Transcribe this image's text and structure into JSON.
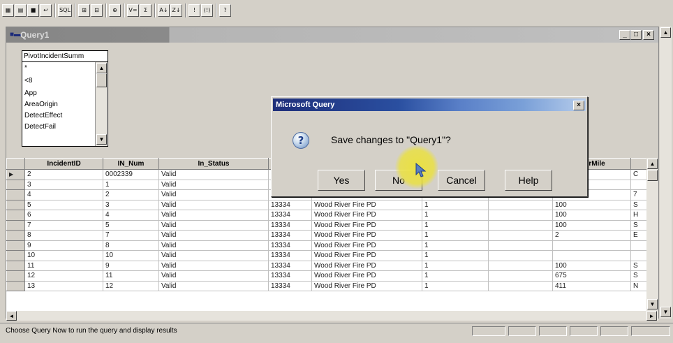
{
  "toolbar": {
    "buttons": [
      {
        "icon": "new-query-icon",
        "glyph": "▦"
      },
      {
        "icon": "open-query-icon",
        "glyph": "▤"
      },
      {
        "icon": "save-icon",
        "glyph": "■"
      },
      {
        "icon": "return-data-icon",
        "glyph": "↩"
      },
      {
        "icon": "sql-icon",
        "glyph": "SQL"
      },
      {
        "icon": "show-tables-icon",
        "glyph": "⊞"
      },
      {
        "icon": "show-criteria-icon",
        "glyph": "⊟"
      },
      {
        "icon": "add-tables-icon",
        "glyph": "⊕"
      },
      {
        "icon": "criteria-equals-icon",
        "glyph": "V="
      },
      {
        "icon": "totals-icon",
        "glyph": "Σ"
      },
      {
        "icon": "sort-ascending-icon",
        "glyph": "A↓"
      },
      {
        "icon": "sort-descending-icon",
        "glyph": "Z↓"
      },
      {
        "icon": "query-now-icon",
        "glyph": "!"
      },
      {
        "icon": "auto-query-icon",
        "glyph": "(!)"
      },
      {
        "icon": "help-icon",
        "glyph": "?"
      }
    ]
  },
  "window": {
    "title": "Query1",
    "icon": "query-window-icon"
  },
  "field_list": {
    "table_name": "PivotIncidentSumm",
    "fields": [
      "*",
      "<8",
      "App",
      "AreaOrigin",
      "DetectEffect",
      "DetectFail"
    ]
  },
  "grid": {
    "columns": [
      "IncidentID",
      "IN_Num",
      "In_Status",
      "",
      "",
      "",
      "",
      "morMile",
      ""
    ],
    "rows": [
      [
        "2",
        "0002339",
        "Valid",
        "",
        "",
        "",
        "",
        "",
        "C"
      ],
      [
        "3",
        "1",
        "Valid",
        "",
        "",
        "",
        "",
        "",
        ""
      ],
      [
        "4",
        "2",
        "Valid",
        "",
        "",
        "",
        "",
        "",
        "7"
      ],
      [
        "5",
        "3",
        "Valid",
        "13334",
        "Wood River Fire PD",
        "1",
        "",
        "100",
        "S"
      ],
      [
        "6",
        "4",
        "Valid",
        "13334",
        "Wood River Fire PD",
        "1",
        "",
        "100",
        "H"
      ],
      [
        "7",
        "5",
        "Valid",
        "13334",
        "Wood River Fire PD",
        "1",
        "",
        "100",
        "S"
      ],
      [
        "8",
        "7",
        "Valid",
        "13334",
        "Wood River Fire PD",
        "1",
        "",
        "2",
        "E"
      ],
      [
        "9",
        "8",
        "Valid",
        "13334",
        "Wood River Fire PD",
        "1",
        "",
        "",
        ""
      ],
      [
        "10",
        "10",
        "Valid",
        "13334",
        "Wood River Fire PD",
        "1",
        "",
        "",
        ""
      ],
      [
        "11",
        "9",
        "Valid",
        "13334",
        "Wood River Fire PD",
        "1",
        "",
        "100",
        "S"
      ],
      [
        "12",
        "11",
        "Valid",
        "13334",
        "Wood River Fire PD",
        "1",
        "",
        "675",
        "S"
      ],
      [
        "13",
        "12",
        "Valid",
        "13334",
        "Wood River Fire PD",
        "1",
        "",
        "411",
        "N"
      ]
    ]
  },
  "dialog": {
    "title": "Microsoft Query",
    "message": "Save changes to \"Query1\"?",
    "buttons": {
      "yes": "Yes",
      "no": "No",
      "cancel": "Cancel",
      "help": "Help"
    },
    "close": "×"
  },
  "status": {
    "text": "Choose Query Now to run the query and display results"
  },
  "colors": {
    "dialog_title_start": "#1f2f7a",
    "dialog_title_end": "#b6cceb",
    "highlight": "#ebe13c",
    "face": "#d4d0c8"
  }
}
